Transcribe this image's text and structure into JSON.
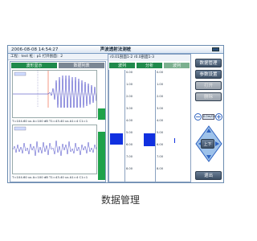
{
  "app": {
    "datetime": "2006-08-08 14:54:27",
    "title": "声波透射法测桩",
    "caption": "数据管理"
  },
  "info": {
    "text": "工程：test  桩：p1  打开剖面：2"
  },
  "left_panel": {
    "tabs": [
      {
        "label": "波形显示"
      },
      {
        "label": "数据列表"
      }
    ],
    "plot1_stats": "T=104.60 us  A=100 dB  T1=43.40 us  A1=4  C1=1",
    "plot2_stats": "T=104.60 us  A=100 dB  T1=43.40 us  A1=4  C1=1"
  },
  "mid_panel": {
    "header": "r0.01剖面1-2   r0.0剖面1-3",
    "tabs": [
      {
        "label": "波列"
      },
      {
        "label": "分析"
      },
      {
        "label": "波列"
      }
    ],
    "ticks": [
      "0.00",
      "1.00",
      "2.00",
      "3.00",
      "4.00",
      "5.00",
      "6.00",
      "7.00",
      "8.00",
      "9.00"
    ]
  },
  "right_panel": {
    "buttons": [
      {
        "label": "数据管理",
        "disabled": false
      },
      {
        "label": "参数设置",
        "disabled": false
      },
      {
        "label": "打开",
        "disabled": true
      },
      {
        "label": "删除",
        "disabled": true
      }
    ],
    "minus": "−",
    "plus": "+",
    "range_label": "0.0m/0.0m",
    "center_button": "上下",
    "exit_button": "退出"
  }
}
